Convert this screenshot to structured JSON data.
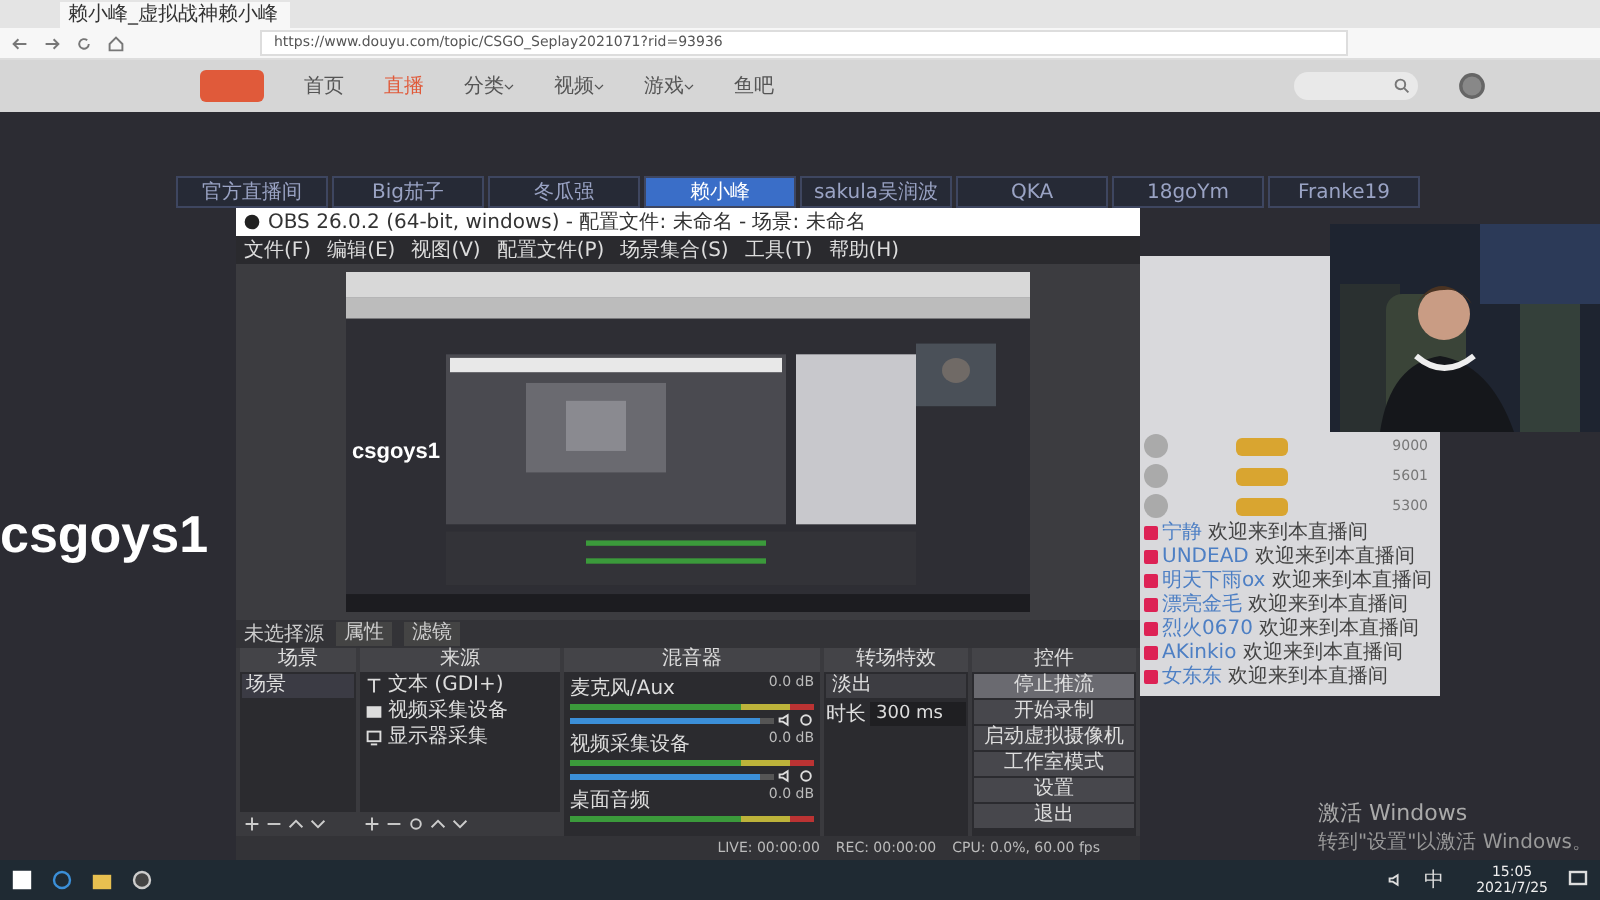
{
  "browser": {
    "tab_title": "赖小峰_虚拟战神赖小峰",
    "url": "https://www.douyu.com/topic/CSGO_Seplay2021071?rid=93936"
  },
  "site_nav": [
    {
      "label": "首页",
      "selected": false,
      "dropdown": false
    },
    {
      "label": "直播",
      "selected": true,
      "dropdown": false
    },
    {
      "label": "分类",
      "selected": false,
      "dropdown": true
    },
    {
      "label": "视频",
      "selected": false,
      "dropdown": true
    },
    {
      "label": "游戏",
      "selected": false,
      "dropdown": true
    },
    {
      "label": "鱼吧",
      "selected": false,
      "dropdown": false
    }
  ],
  "streamer_tabs": [
    {
      "label": "官方直播间",
      "selected": false
    },
    {
      "label": "Big茄子",
      "selected": false
    },
    {
      "label": "冬瓜强",
      "selected": false
    },
    {
      "label": "赖小峰",
      "selected": true
    },
    {
      "label": "sakula吴润波",
      "selected": false
    },
    {
      "label": "QKA",
      "selected": false
    },
    {
      "label": "18goYm",
      "selected": false
    },
    {
      "label": "Franke19",
      "selected": false
    }
  ],
  "overlay_text": "csgoys1",
  "obs": {
    "title": "OBS 26.0.2 (64-bit, windows) - 配置文件: 未命名 - 场景: 未命名",
    "menu": [
      "文件(F)",
      "编辑(E)",
      "视图(V)",
      "配置文件(P)",
      "场景集合(S)",
      "工具(T)",
      "帮助(H)"
    ],
    "preview_label": "csgoys1",
    "no_source": "未选择源",
    "source_buttons": [
      "属性",
      "滤镜"
    ],
    "scenes": {
      "title": "场景",
      "items": [
        {
          "label": "场景",
          "selected": true
        }
      ]
    },
    "sources": {
      "title": "来源",
      "items": [
        {
          "label": "文本 (GDI+)",
          "kind": "text"
        },
        {
          "label": "视频采集设备",
          "kind": "camera"
        },
        {
          "label": "显示器采集",
          "kind": "monitor"
        }
      ]
    },
    "mixer": {
      "title": "混音器",
      "channels": [
        {
          "name": "麦克风/Aux",
          "reading": "0.0 dB",
          "level": 0.93
        },
        {
          "name": "视频采集设备",
          "reading": "0.0 dB",
          "level": 0.93
        },
        {
          "name": "桌面音频",
          "reading": "0.0 dB"
        }
      ]
    },
    "transitions": {
      "title": "转场特效",
      "type": "淡出",
      "duration_label": "时长",
      "duration": "300 ms"
    },
    "controls": {
      "title": "控件",
      "buttons": [
        {
          "label": "停止推流",
          "selected": true
        },
        {
          "label": "开始录制",
          "selected": false
        },
        {
          "label": "启动虚拟摄像机",
          "selected": false
        },
        {
          "label": "工作室模式",
          "selected": false
        },
        {
          "label": "设置",
          "selected": false
        },
        {
          "label": "退出",
          "selected": false
        }
      ]
    },
    "status": {
      "live": "LIVE: 00:00:00",
      "rec": "REC: 00:00:00",
      "cpu": "CPU: 0.0%, 60.00 fps"
    }
  },
  "chat": {
    "ranking": [
      {
        "score": "9000"
      },
      {
        "score": "5601"
      },
      {
        "score": "5300"
      }
    ],
    "messages": [
      {
        "user": "宁静",
        "text": "欢迎来到本直播间"
      },
      {
        "user": "UNDEAD",
        "text": "欢迎来到本直播间"
      },
      {
        "user": "明天下雨ox",
        "text": "欢迎来到本直播间"
      },
      {
        "user": "漂亮金毛",
        "text": "欢迎来到本直播间"
      },
      {
        "user": "烈火0670",
        "text": "欢迎来到本直播间"
      },
      {
        "user": "AKinkio",
        "text": "欢迎来到本直播间"
      },
      {
        "user": "女东东",
        "text": "欢迎来到本直播间"
      }
    ]
  },
  "desktop": {
    "activation_title": "激活 Windows",
    "activation_hint": "转到\"设置\"以激活 Windows。"
  },
  "taskbar": {
    "ime": "中",
    "time": "15:05",
    "date": "2021/7/25"
  }
}
